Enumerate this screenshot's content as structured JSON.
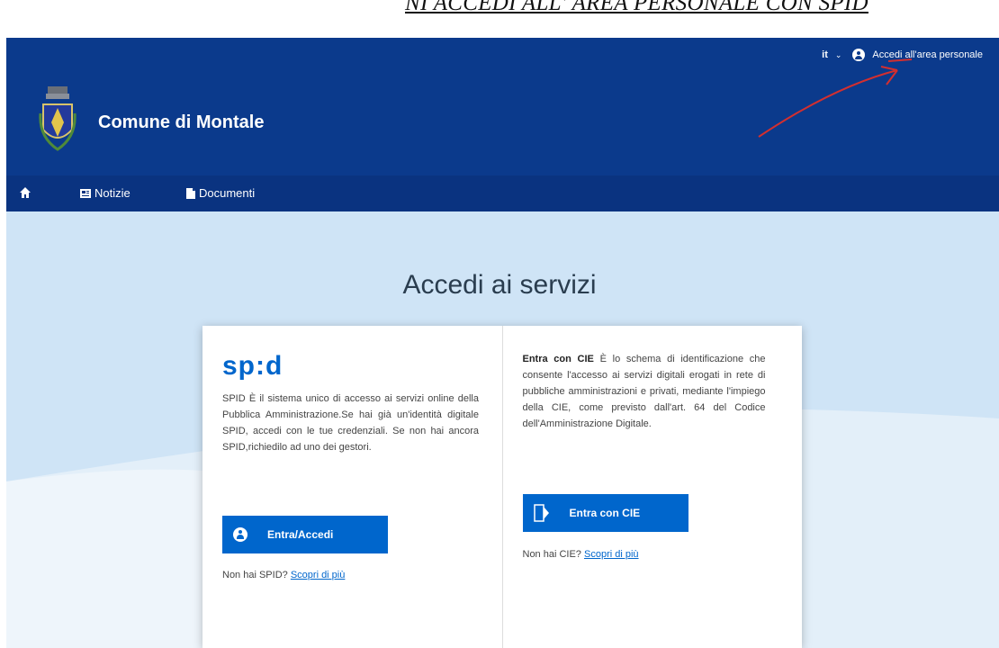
{
  "caption": "NI ACCEDI ALL' AREA PERSONALE CON SPID",
  "header": {
    "lang": "it",
    "login_label": "Accedi all'area personale",
    "site_title": "Comune di Montale"
  },
  "nav": {
    "items": [
      {
        "label": "Notizie",
        "icon": "newspaper-icon"
      },
      {
        "label": "Documenti",
        "icon": "document-icon"
      }
    ]
  },
  "hero": {
    "title": "Accedi ai servizi"
  },
  "spid": {
    "logo": "sp:d",
    "text": "SPID È il sistema unico di accesso ai servizi online della Pubblica Amministrazione.Se hai già un'identità digitale SPID, accedi con le tue credenziali. Se non hai ancora SPID,richiedilo ad uno dei gestori.",
    "button_label": "Entra/Accedi",
    "help_text": "Non hai SPID?",
    "help_link": "Scopri di più"
  },
  "cie": {
    "intro_bold": "Entra con CIE",
    "text": "È lo schema di identificazione che consente l'accesso ai servizi digitali erogati in rete di pubbliche amministrazioni e privati, mediante l'impiego della CIE, come previsto dall'art. 64 del Codice dell'Amministrazione Digitale.",
    "button_label": "Entra con CIE",
    "help_text": "Non hai CIE?",
    "help_link": "Scopri di più"
  },
  "colors": {
    "header_blue": "#0b3a8c",
    "primary_button": "#0066cc",
    "hero_bg": "#cfe4f6",
    "annotation_arrow": "#d32f2f"
  }
}
